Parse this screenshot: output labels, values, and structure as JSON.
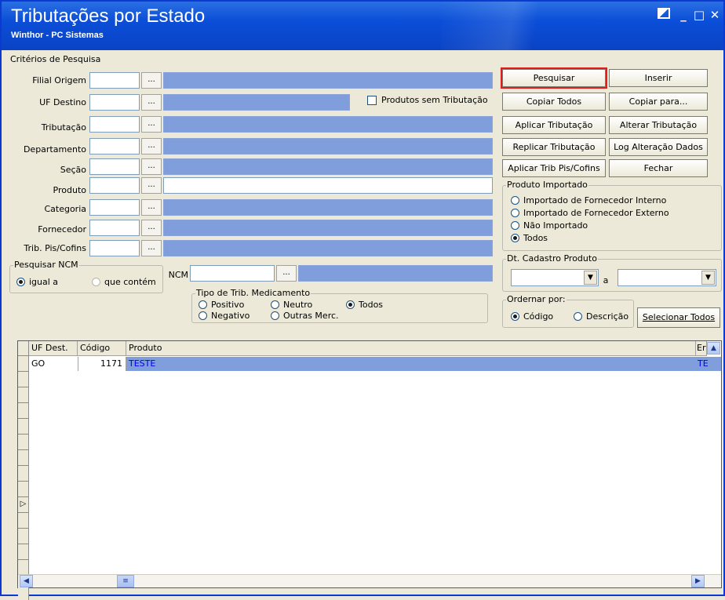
{
  "window": {
    "title": "Tributações por Estado",
    "subtitle": "Winthor - PC Sistemas",
    "controls": {
      "minimize": "_",
      "maximize": "□",
      "close": "✕"
    }
  },
  "criteria": {
    "legend": "Critérios de Pesquisa",
    "fields": [
      {
        "key": "filial",
        "label": "Filial Origem",
        "value": ""
      },
      {
        "key": "uf",
        "label": "UF Destino",
        "value": ""
      },
      {
        "key": "trib",
        "label": "Tributação",
        "value": ""
      },
      {
        "key": "depto",
        "label": "Departamento",
        "value": ""
      },
      {
        "key": "secao",
        "label": "Seção",
        "value": ""
      },
      {
        "key": "produto",
        "label": "Produto",
        "value": ""
      },
      {
        "key": "categoria",
        "label": "Categoria",
        "value": ""
      },
      {
        "key": "fornecedor",
        "label": "Fornecedor",
        "value": ""
      },
      {
        "key": "tribpis",
        "label": "Trib. Pis/Cofins",
        "value": ""
      }
    ],
    "ellipsis": "...",
    "produtos_sem_trib": "Produtos sem Tributação",
    "ncm_group": {
      "legend": "Pesquisar NCM",
      "opt1": "igual a",
      "opt2": "que contém",
      "ncm_label": "NCM"
    },
    "medicamento": {
      "legend": "Tipo de Trib. Medicamento",
      "positivo": "Positivo",
      "neutro": "Neutro",
      "todos": "Todos",
      "negativo": "Negativo",
      "outras": "Outras Merc."
    }
  },
  "buttons": {
    "pesquisar": "Pesquisar",
    "inserir": "Inserir",
    "copiar_todos": "Copiar Todos",
    "copiar_para": "Copiar para...",
    "aplicar_trib": "Aplicar Tributação",
    "alterar_trib": "Alterar Tributação",
    "replicar_trib": "Replicar Tributação",
    "log_alteracao": "Log Alteração Dados",
    "aplicar_pis": "Aplicar Trib Pis/Cofins",
    "fechar": "Fechar",
    "selecionar_todos": "Selecionar Todos"
  },
  "produto_importado": {
    "legend": "Produto Importado",
    "opt1": "Importado de Fornecedor Interno",
    "opt2": "Importado de Fornecedor Externo",
    "opt3": "Não Importado",
    "opt4": "Todos",
    "selected": "Todos"
  },
  "dt_cadastro": {
    "legend": "Dt. Cadastro Produto",
    "sep": "a"
  },
  "ordenar": {
    "legend": "Ordernar por:",
    "codigo": "Código",
    "descricao": "Descrição"
  },
  "grid": {
    "columns": [
      "UF Dest.",
      "Código",
      "Produto",
      "Er"
    ],
    "rows": [
      {
        "uf": "GO",
        "codigo": "1171",
        "produto": "TESTE",
        "extra": "TE"
      }
    ]
  },
  "colors": {
    "title_blue": "#0b4ed8",
    "selection": "#7f9edb",
    "highlight": "#e51b1b"
  }
}
